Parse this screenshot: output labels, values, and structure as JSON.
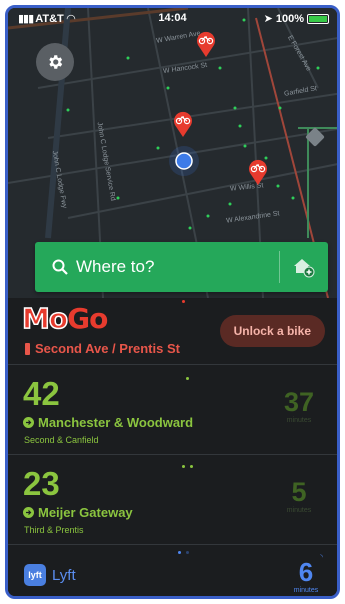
{
  "status_bar": {
    "carrier": "AT&T",
    "time": "14:04",
    "battery": "100%"
  },
  "map": {
    "streets": [
      "W Warren Ave",
      "W Hancock St",
      "E Forest Ave",
      "Garfield St",
      "John C Lodge Service Rd",
      "John C Lodge Fwy",
      "W Willis St",
      "W Alexandrine St"
    ],
    "marker_color": "#e73b2e",
    "user_location_color": "#3d7be8"
  },
  "search": {
    "placeholder": "Where to?"
  },
  "provider": {
    "logo_mo": "Mo",
    "logo_go": "Go",
    "location": "Second Ave / Prentis St",
    "unlock_label": "Unlock a bike"
  },
  "stations": [
    {
      "count": "42",
      "name": "Manchester & Woodward",
      "cross": "Second & Canfield",
      "minutes": "37",
      "minutes_label": "minutes"
    },
    {
      "count": "23",
      "name": "Meijer Gateway",
      "cross": "Third & Prentis",
      "minutes": "5",
      "minutes_label": "minutes"
    }
  ],
  "lyft": {
    "logo_text": "lyft",
    "name": "Lyft",
    "minutes": "6",
    "minutes_label": "minutes"
  },
  "colors": {
    "accent_green": "#25a85a",
    "station_green": "#8bc53f",
    "mogo_red": "#e73b2e",
    "lyft_blue": "#4f86f0"
  }
}
